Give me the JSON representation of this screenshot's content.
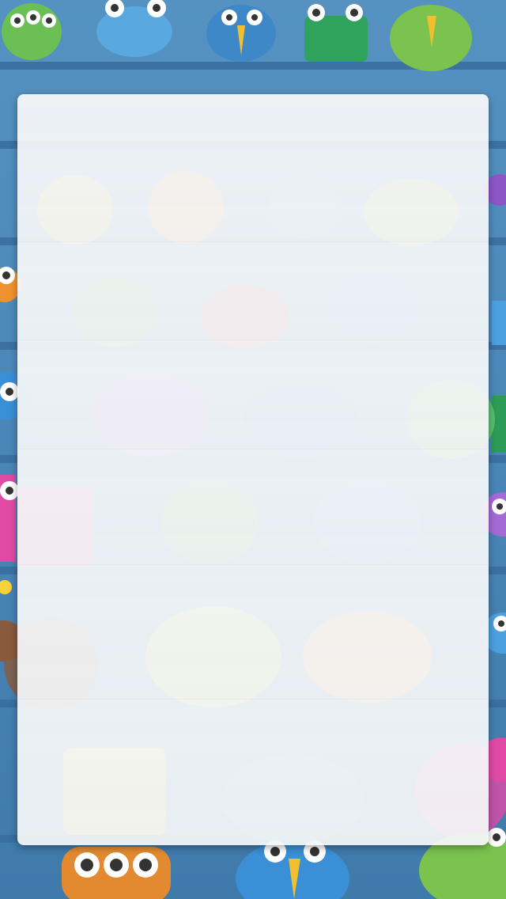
{
  "screen": {
    "kind": "modal-overlay",
    "panel_state": "empty",
    "background_art": "monster-characters-on-shelves",
    "colors": {
      "background": "#4a86b8",
      "shelf": "#3a6f9e",
      "panel": "#f6f7f9"
    },
    "rows": 6
  }
}
